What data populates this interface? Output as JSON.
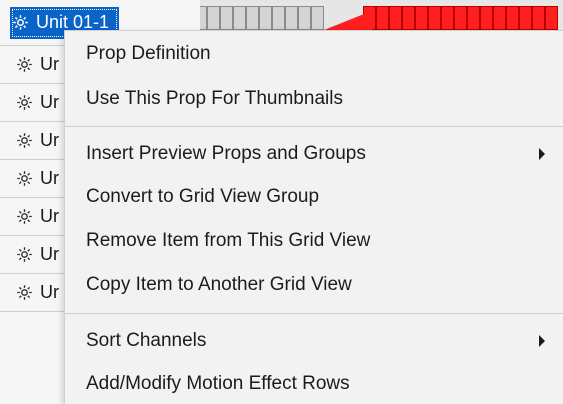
{
  "units": [
    {
      "label": "Unit 01-1",
      "selected": true
    },
    {
      "label": "Ur"
    },
    {
      "label": "Ur"
    },
    {
      "label": "Ur"
    },
    {
      "label": "Ur"
    },
    {
      "label": "Ur"
    },
    {
      "label": "Ur"
    },
    {
      "label": "Ur"
    }
  ],
  "menu": {
    "items": [
      {
        "label": "Prop Definition"
      },
      {
        "label": "Use This Prop For Thumbnails"
      },
      {
        "label": "Insert Preview Props and Groups",
        "submenu": true
      },
      {
        "label": "Convert to Grid View Group"
      },
      {
        "label": "Remove Item from This Grid View"
      },
      {
        "label": "Copy Item to Another Grid View"
      },
      {
        "label": "Sort Channels",
        "submenu": true
      },
      {
        "label": "Add/Modify Motion Effect Rows"
      }
    ]
  },
  "colors": {
    "selection": "#0a64c8",
    "effect_red": "#ff1f1f",
    "menu_bg": "#f2f2f2"
  },
  "icons": {
    "unit_icon": "gear-icon",
    "submenu_icon": "chevron-right-icon"
  }
}
